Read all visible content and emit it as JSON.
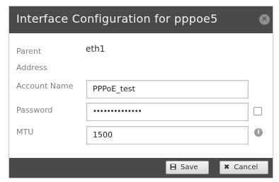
{
  "dialog": {
    "title": "Interface Configuration for pppoe5",
    "close_icon": "close-icon"
  },
  "fields": {
    "parent_label": "Parent",
    "parent_value": "eth1",
    "address_label": "Address",
    "account_label": "Account Name",
    "account_value": "PPPoE_test",
    "password_label": "Password",
    "password_value": "••••••••••••••",
    "mtu_label": "MTU",
    "mtu_value": "1500"
  },
  "footer": {
    "save_label": "Save",
    "save_icon": "floppy-disk-icon",
    "cancel_label": "Cancel",
    "cancel_icon": "x-icon"
  },
  "colors": {
    "titlebar": "#4a4a4a",
    "footer": "#4a4a4a"
  }
}
